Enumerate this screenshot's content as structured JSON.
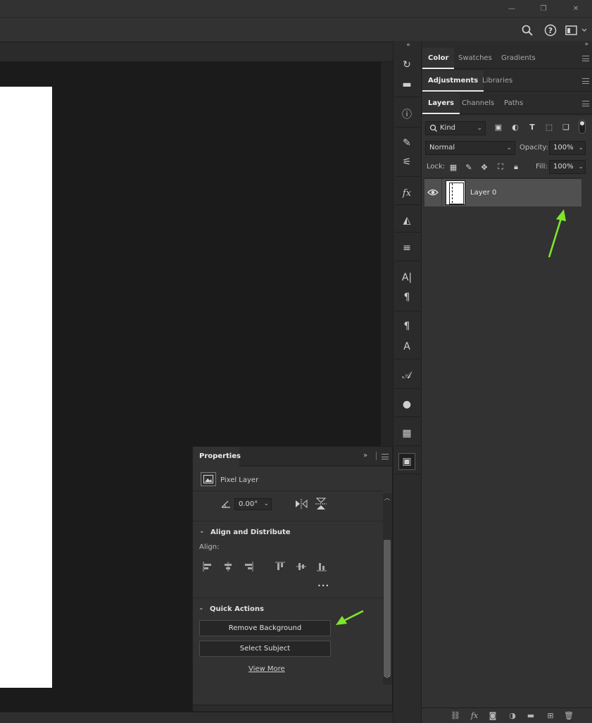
{
  "window": {
    "minimize_glyph": "—",
    "restore_glyph": "❐",
    "close_glyph": "✕"
  },
  "options_bar": {
    "icons": [
      "search-icon",
      "help-icon",
      "workspace-icon"
    ]
  },
  "tool_column": {
    "collapse_glyph": "«",
    "tools": [
      {
        "name": "history-icon",
        "glyph": "↻"
      },
      {
        "name": "comments-icon",
        "glyph": "▬"
      },
      {
        "name": "info-icon",
        "glyph": "ⓘ"
      },
      {
        "name": "brush-settings-icon",
        "glyph": "✎"
      },
      {
        "name": "brushes-icon",
        "glyph": "⚟"
      },
      {
        "name": "styles-icon",
        "glyph": "fx"
      },
      {
        "name": "shapes-icon",
        "glyph": "◭"
      },
      {
        "name": "clone-source-icon",
        "glyph": "≡"
      },
      {
        "name": "character-icon",
        "glyph": "A|"
      },
      {
        "name": "paragraph-icon",
        "glyph": "¶"
      },
      {
        "name": "paragraph-styles-icon",
        "glyph": "¶"
      },
      {
        "name": "character-styles-icon",
        "glyph": "A"
      },
      {
        "name": "glyphs-icon",
        "glyph": "𝒜"
      },
      {
        "name": "materials-icon",
        "glyph": "●"
      },
      {
        "name": "timeline-icon",
        "glyph": "▦"
      },
      {
        "name": "properties-icon",
        "glyph": "▣"
      }
    ]
  },
  "right_dock": {
    "expand_glyph": "»",
    "group1_tabs": [
      "Color",
      "Swatches",
      "Gradients"
    ],
    "group2_tabs": [
      "Adjustments",
      "Libraries"
    ],
    "group3_tabs": [
      "Layers",
      "Channels",
      "Paths"
    ]
  },
  "layers": {
    "filter_kind": "Kind",
    "blend_mode": "Normal",
    "opacity_label": "Opacity:",
    "opacity_value": "100%",
    "lock_label": "Lock:",
    "fill_label": "Fill:",
    "fill_value": "100%",
    "layer_name": "Layer 0",
    "footer_icons": [
      "link-icon",
      "fx-icon",
      "mask-icon",
      "adjustment-icon",
      "group-folder-icon",
      "new-layer-icon",
      "trash-icon"
    ]
  },
  "properties": {
    "tab": "Properties",
    "layer_type": "Pixel Layer",
    "angle_value": "0.00°",
    "align_section": "Align and Distribute",
    "align_label": "Align:",
    "more_glyph": "•••",
    "quick_actions_section": "Quick Actions",
    "remove_background": "Remove Background",
    "select_subject": "Select Subject",
    "view_more": "View More"
  },
  "annotations": {
    "arrow_color": "#7fe62a"
  }
}
